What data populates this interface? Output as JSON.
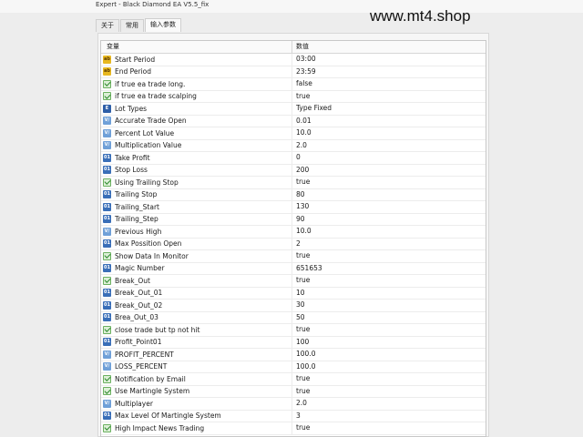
{
  "window": {
    "title": "Expert - Black Diamond EA V5.5_fix"
  },
  "watermark": "www.mt4.shop",
  "tabs": [
    {
      "label": "关于",
      "active": false
    },
    {
      "label": "常用",
      "active": false
    },
    {
      "label": "输入参数",
      "active": true
    }
  ],
  "grid": {
    "columns": [
      "变量",
      "数值"
    ],
    "rows": [
      {
        "name": "Start Period",
        "value": "03:00",
        "type": "ab"
      },
      {
        "name": "End Period",
        "value": "23:59",
        "type": "ab"
      },
      {
        "name": "if true ea trade long.",
        "value": "false",
        "type": "bool"
      },
      {
        "name": "if true ea trade scalping",
        "value": "true",
        "type": "bool"
      },
      {
        "name": "Lot Types",
        "value": "Type Fixed",
        "type": "enum"
      },
      {
        "name": "Accurate Trade Open",
        "value": "0.01",
        "type": "dbl"
      },
      {
        "name": "Percent Lot Value",
        "value": "10.0",
        "type": "dbl"
      },
      {
        "name": "Multiplication Value",
        "value": "2.0",
        "type": "dbl"
      },
      {
        "name": "Take Profit",
        "value": "0",
        "type": "int"
      },
      {
        "name": "Stop Loss",
        "value": "200",
        "type": "int"
      },
      {
        "name": "Using Trailing Stop",
        "value": "true",
        "type": "bool"
      },
      {
        "name": "Trailing Stop",
        "value": "80",
        "type": "int"
      },
      {
        "name": "Trailing_Start",
        "value": "130",
        "type": "int"
      },
      {
        "name": "Trailing_Step",
        "value": "90",
        "type": "int"
      },
      {
        "name": "Previous High",
        "value": "10.0",
        "type": "dbl"
      },
      {
        "name": "Max Possition Open",
        "value": "2",
        "type": "int"
      },
      {
        "name": "Show Data In Monitor",
        "value": "true",
        "type": "bool"
      },
      {
        "name": "Magic Number",
        "value": "651653",
        "type": "int"
      },
      {
        "name": "Break_Out",
        "value": "true",
        "type": "bool"
      },
      {
        "name": "Break_Out_01",
        "value": "10",
        "type": "int"
      },
      {
        "name": "Break_Out_02",
        "value": "30",
        "type": "int"
      },
      {
        "name": "Brea_Out_03",
        "value": "50",
        "type": "int"
      },
      {
        "name": "close trade but tp not hit",
        "value": "true",
        "type": "bool"
      },
      {
        "name": "Profit_Point01",
        "value": "100",
        "type": "int"
      },
      {
        "name": "PROFIT_PERCENT",
        "value": "100.0",
        "type": "dbl"
      },
      {
        "name": "LOSS_PERCENT",
        "value": "100.0",
        "type": "dbl"
      },
      {
        "name": "Notification by Email",
        "value": "true",
        "type": "bool"
      },
      {
        "name": "Use Martingle System",
        "value": "true",
        "type": "bool"
      },
      {
        "name": "Multiplayer",
        "value": "2.0",
        "type": "dbl"
      },
      {
        "name": "Max Level Of Martingle System",
        "value": "3",
        "type": "int"
      },
      {
        "name": "High Impact News Trading",
        "value": "true",
        "type": "bool"
      }
    ]
  }
}
